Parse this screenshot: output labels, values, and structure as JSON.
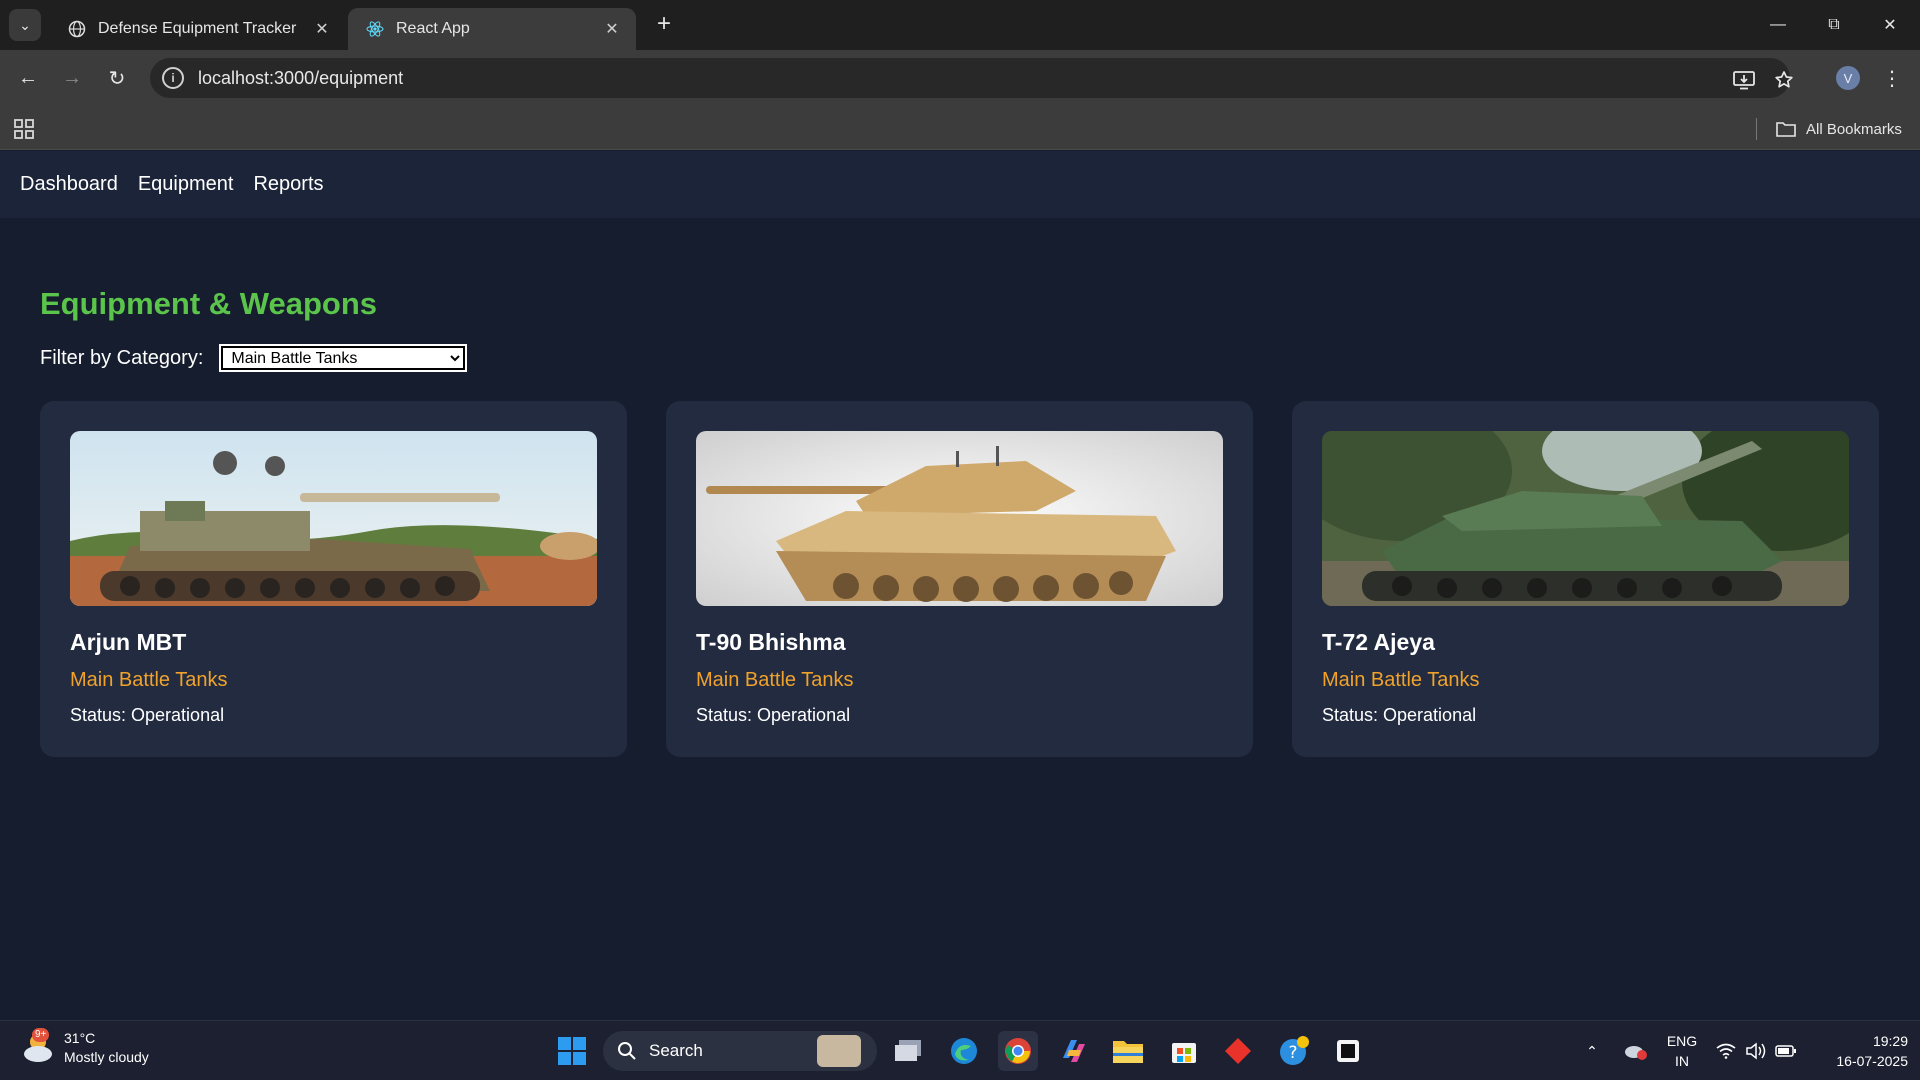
{
  "browser": {
    "tabs": [
      {
        "title": "Defense Equipment Tracker",
        "active": false
      },
      {
        "title": "React App",
        "active": true
      }
    ],
    "url": "localhost:3000/equipment",
    "profile_initial": "V",
    "bookmarks_label": "All Bookmarks"
  },
  "app": {
    "nav": [
      "Dashboard",
      "Equipment",
      "Reports"
    ],
    "page_title": "Equipment & Weapons",
    "filter": {
      "label": "Filter by Category:",
      "selected": "Main Battle Tanks"
    },
    "cards": [
      {
        "name": "Arjun MBT",
        "category": "Main Battle Tanks",
        "status": "Status: Operational",
        "image": "arjun-tank-photo"
      },
      {
        "name": "T-90 Bhishma",
        "category": "Main Battle Tanks",
        "status": "Status: Operational",
        "image": "t90-tank-photo"
      },
      {
        "name": "T-72 Ajeya",
        "category": "Main Battle Tanks",
        "status": "Status: Operational",
        "image": "t72-tank-photo"
      }
    ]
  },
  "taskbar": {
    "weather": {
      "temp": "31°C",
      "condition": "Mostly cloudy",
      "badge": "9+"
    },
    "search_label": "Search",
    "lang": {
      "line1": "ENG",
      "line2": "IN"
    },
    "clock": {
      "time": "19:29",
      "date": "16-07-2025"
    }
  },
  "colors": {
    "page_bg": "#161d2e",
    "nav_bg": "#1b2438",
    "card_bg": "#222b40",
    "title_green": "#5bc54b",
    "category_orange": "#f0a22b"
  }
}
